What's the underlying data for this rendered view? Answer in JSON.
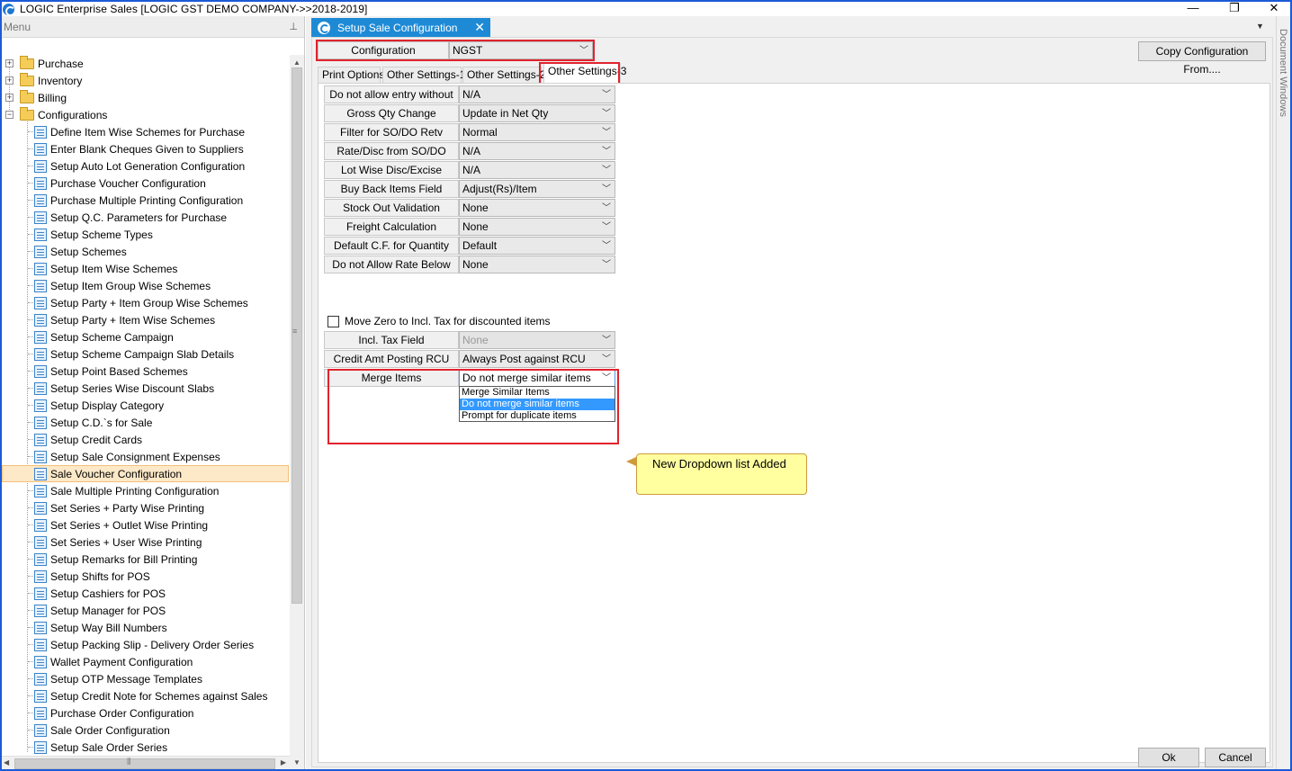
{
  "window": {
    "title": "LOGIC Enterprise Sales  [LOGIC GST DEMO COMPANY->>2018-2019]",
    "controls": {
      "minimize": "—",
      "maximize": "❐",
      "close": "✕"
    }
  },
  "menu": {
    "header": "Menu",
    "pin_glyph": "📌",
    "folders": [
      {
        "label": "Purchase",
        "expanded": false
      },
      {
        "label": "Inventory",
        "expanded": false
      },
      {
        "label": "Billing",
        "expanded": false
      },
      {
        "label": "Configurations",
        "expanded": true
      }
    ],
    "items": [
      "Define Item Wise Schemes for Purchase",
      "Enter Blank Cheques Given to Suppliers",
      "Setup Auto Lot Generation Configuration",
      "Purchase Voucher Configuration",
      "Purchase Multiple Printing Configuration",
      "Setup Q.C. Parameters for Purchase",
      "Setup Scheme Types",
      "Setup Schemes",
      "Setup Item Wise Schemes",
      "Setup Item Group Wise Schemes",
      "Setup Party + Item Group Wise Schemes",
      "Setup Party + Item Wise Schemes",
      "Setup Scheme Campaign",
      "Setup Scheme Campaign Slab Details",
      "Setup Point Based Schemes",
      "Setup Series Wise Discount Slabs",
      "Setup Display Category",
      "Setup C.D.`s for Sale",
      "Setup Credit Cards",
      "Setup Sale Consignment Expenses",
      "Sale Voucher Configuration",
      "Sale Multiple Printing Configuration",
      "Set Series + Party Wise Printing",
      "Set Series + Outlet Wise Printing",
      "Set Series + User Wise Printing",
      "Setup Remarks for Bill Printing",
      "Setup Shifts for POS",
      "Setup Cashiers for POS",
      "Setup Manager for POS",
      "Setup Way Bill Numbers",
      "Setup Packing Slip - Delivery Order Series",
      "Wallet Payment Configuration",
      "Setup OTP Message Templates",
      "Setup Credit Note for Schemes against Sales",
      "Purchase Order Configuration",
      "Sale Order Configuration",
      "Setup Sale Order Series"
    ],
    "selected_item": "Sale Voucher Configuration"
  },
  "document": {
    "tab_title": "Setup Sale Configuration",
    "close_glyph": "✕",
    "side_label": "Document Windows"
  },
  "config": {
    "label": "Configuration",
    "value": "NGST",
    "copy_button": "Copy Configuration From...."
  },
  "tabs": [
    "Print Options",
    "Other Settings-1",
    "Other Settings-2",
    "Other Settings-3"
  ],
  "active_tab": "Other Settings-3",
  "settings": [
    {
      "label": "Do not allow entry without",
      "value": "N/A"
    },
    {
      "label": "Gross Qty Change",
      "value": "Update in Net Qty"
    },
    {
      "label": "Filter for SO/DO Retv",
      "value": "Normal"
    },
    {
      "label": "Rate/Disc from SO/DO",
      "value": "N/A"
    },
    {
      "label": "Lot Wise Disc/Excise",
      "value": "N/A"
    },
    {
      "label": "Buy Back Items Field",
      "value": "Adjust(Rs)/Item"
    },
    {
      "label": "Stock Out Validation",
      "value": "None"
    },
    {
      "label": "Freight Calculation",
      "value": "None"
    },
    {
      "label": "Default C.F. for Quantity",
      "value": "Default"
    },
    {
      "label": "Do not Allow Rate Below",
      "value": "None"
    }
  ],
  "checkbox": {
    "label": "Move Zero to Incl. Tax for discounted items",
    "checked": false
  },
  "settings2": [
    {
      "label": "Incl. Tax Field",
      "value": "None",
      "disabled": true
    },
    {
      "label": "Credit Amt Posting RCU",
      "value": "Always Post against RCU"
    },
    {
      "label": "Merge Items",
      "value": "Do not merge similar items"
    }
  ],
  "dropdown": {
    "options": [
      "Merge Similar Items",
      "Do not merge similar items",
      "Prompt for duplicate items"
    ],
    "selected": "Do not merge similar items"
  },
  "callout": {
    "text": "New Dropdown list Added"
  },
  "buttons": {
    "ok": "Ok",
    "cancel": "Cancel"
  },
  "colors": {
    "accent": "#1e8ad6",
    "highlight_box": "#e0232d",
    "callout_bg": "#ffffa0",
    "selection": "#3399ff"
  }
}
